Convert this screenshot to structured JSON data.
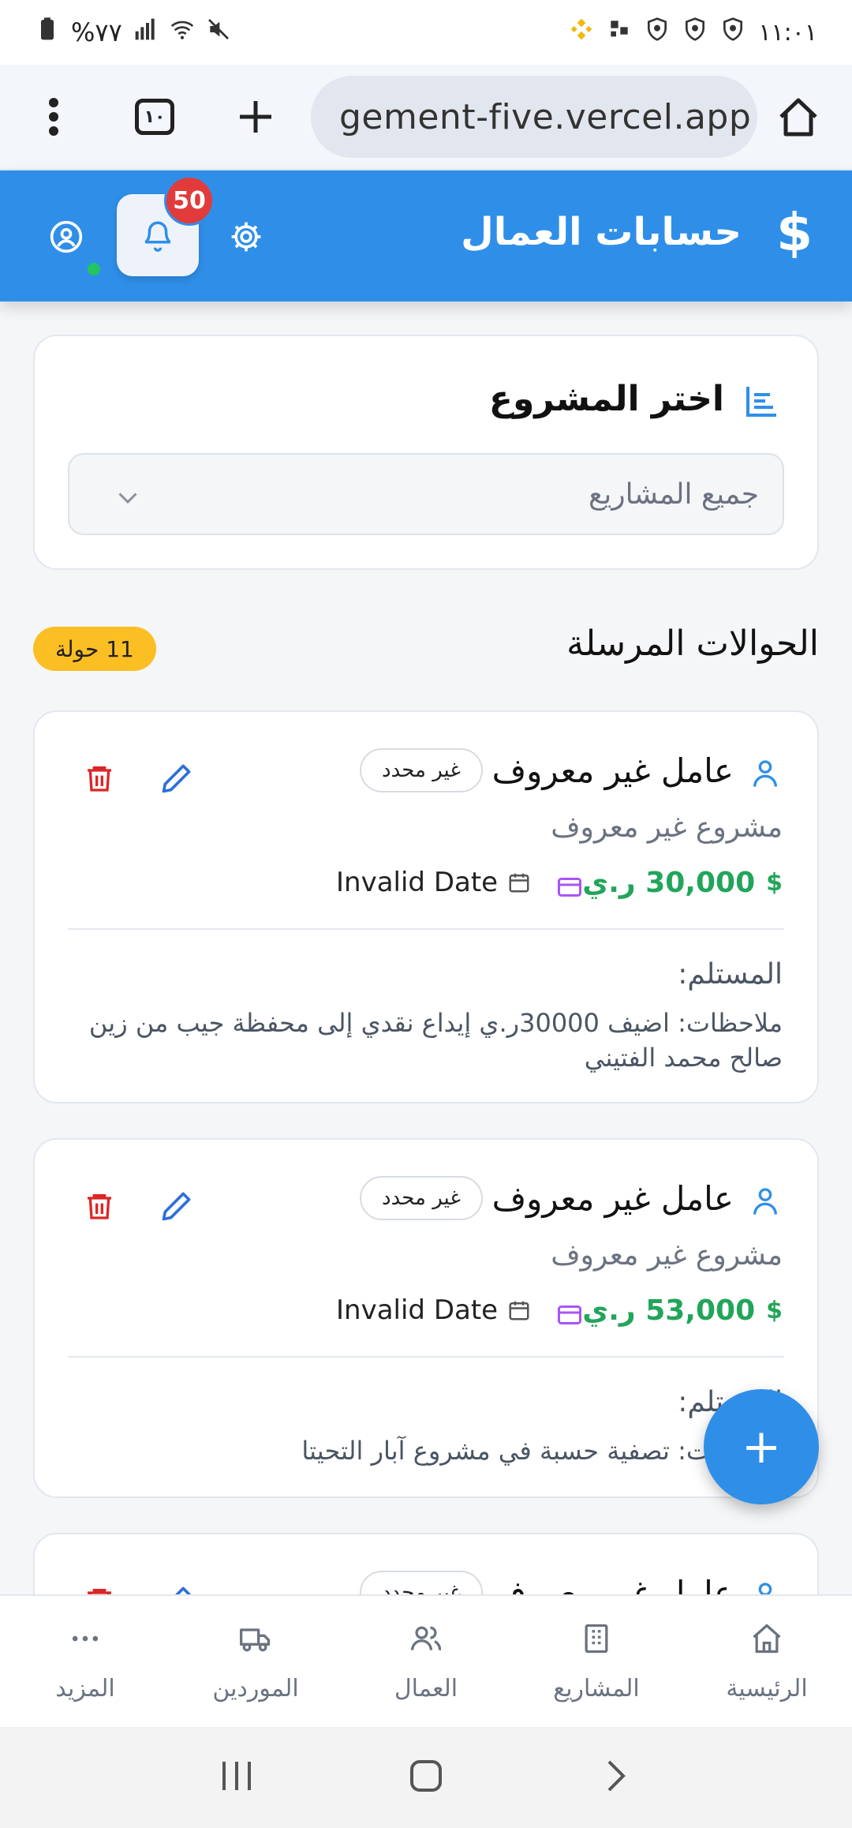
{
  "status_bar": {
    "time": "١١:٠١",
    "battery": "%٧٧"
  },
  "browser": {
    "tab_count": "١٠",
    "url": "gement-five.vercel.app"
  },
  "app": {
    "title": "حسابات العمال",
    "currency_symbol": "$",
    "notifications_count": "50",
    "accent_color": "#2f8fe8"
  },
  "project_select": {
    "title": "اختر المشروع",
    "selected": "جميع المشاريع"
  },
  "transfers": {
    "title": "الحوالات المرسلة",
    "count_label": "11 حولة",
    "items": [
      {
        "worker": "عامل غير معروف",
        "tag": "غير محدد",
        "project": "مشروع غير معروف",
        "currency": "$",
        "amount": "30,000 ر.ي",
        "date": "Invalid Date",
        "receiver_label": "المستلم:",
        "notes": "ملاحظات: اضيف 30000ر.ي إيداع نقدي إلى محفظة جيب من زين صالح محمد الفتيني"
      },
      {
        "worker": "عامل غير معروف",
        "tag": "غير محدد",
        "project": "مشروع غير معروف",
        "currency": "$",
        "amount": "53,000 ر.ي",
        "date": "Invalid Date",
        "receiver_label": "المستلم:",
        "notes": "ملاحظات: تصفية حسبة في مشروع آبار التحيتا"
      },
      {
        "worker": "عامل غير معروف",
        "tag": "غير محدد"
      }
    ]
  },
  "fab": {
    "label": "+"
  },
  "bottom_nav": [
    {
      "label": "الرئيسية",
      "icon": "home-icon"
    },
    {
      "label": "المشاريع",
      "icon": "building-icon"
    },
    {
      "label": "العمال",
      "icon": "users-icon"
    },
    {
      "label": "الموردين",
      "icon": "truck-icon"
    },
    {
      "label": "المزيد",
      "icon": "more-icon"
    }
  ]
}
